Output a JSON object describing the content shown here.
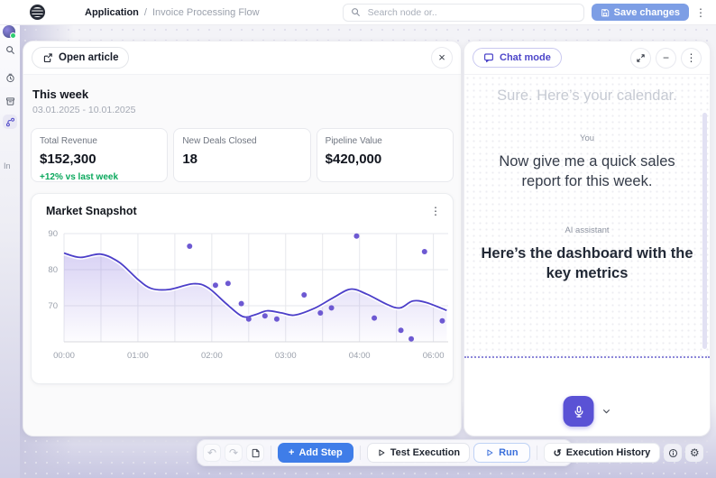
{
  "icons": {
    "close": "×",
    "kebab": "⋮",
    "minus": "−",
    "plus": "+",
    "undo": "↶",
    "redo": "↷",
    "gear": "⚙",
    "history": "↺"
  },
  "topbar": {
    "breadcrumb_app": "Application",
    "breadcrumb_sep": "/",
    "breadcrumb_page": "Invoice Processing Flow",
    "search_placeholder": "Search node or..",
    "save_button": "Save changes"
  },
  "sidebar": {
    "partial_label": "In"
  },
  "left_panel": {
    "open_article": "Open article",
    "week_title": "This week",
    "week_range": "03.01.2025 - 10.01.2025",
    "metrics": [
      {
        "label": "Total Revenue",
        "value": "$152,300",
        "delta": "+12% vs last week"
      },
      {
        "label": "New Deals Closed",
        "value": "18",
        "delta": ""
      },
      {
        "label": "Pipeline Value",
        "value": "$420,000",
        "delta": ""
      }
    ],
    "chart_title": "Market Snapshot"
  },
  "chart_data": {
    "type": "line+scatter",
    "title": "Market Snapshot",
    "x_tick_labels": [
      "00:00",
      "01:00",
      "02:00",
      "03:00",
      "04:00",
      "06:00"
    ],
    "x_tick_slots": [
      0,
      1,
      2,
      3,
      4,
      5
    ],
    "y_ticks": [
      90,
      80,
      70
    ],
    "ylim": [
      60,
      91
    ],
    "xlim": [
      0,
      5.2
    ],
    "grid": true,
    "line_series": {
      "name": "trend",
      "points": [
        [
          0,
          84.6
        ],
        [
          0.22,
          83.4
        ],
        [
          0.5,
          84.3
        ],
        [
          0.75,
          82.0
        ],
        [
          1.0,
          77.3
        ],
        [
          1.18,
          74.8
        ],
        [
          1.42,
          74.5
        ],
        [
          1.75,
          76.1
        ],
        [
          1.95,
          75.0
        ],
        [
          2.2,
          70.5
        ],
        [
          2.42,
          67.0
        ],
        [
          2.6,
          67.6
        ],
        [
          2.75,
          68.6
        ],
        [
          2.95,
          68.0
        ],
        [
          3.12,
          67.4
        ],
        [
          3.4,
          69.4
        ],
        [
          3.65,
          72.3
        ],
        [
          3.88,
          74.6
        ],
        [
          4.1,
          73.2
        ],
        [
          4.38,
          70.3
        ],
        [
          4.55,
          69.4
        ],
        [
          4.72,
          71.3
        ],
        [
          4.9,
          70.9
        ],
        [
          5.18,
          68.7
        ]
      ]
    },
    "scatter_series": {
      "name": "observations",
      "points": [
        [
          1.7,
          86.5
        ],
        [
          2.05,
          75.7
        ],
        [
          2.22,
          76.2
        ],
        [
          2.4,
          70.6
        ],
        [
          2.5,
          66.3
        ],
        [
          2.72,
          67.2
        ],
        [
          2.88,
          66.3
        ],
        [
          3.25,
          73.0
        ],
        [
          3.47,
          68.0
        ],
        [
          3.62,
          69.4
        ],
        [
          3.96,
          89.3
        ],
        [
          4.2,
          66.6
        ],
        [
          4.56,
          63.2
        ],
        [
          4.7,
          60.8
        ],
        [
          4.88,
          85.0
        ],
        [
          5.12,
          65.8
        ]
      ]
    },
    "colors": {
      "line": "#4c3fc9",
      "area": "#8f7ce0",
      "dots": "#6d59d2",
      "grid": "#e6e7ec",
      "axis": "#d8dade"
    }
  },
  "chat_panel": {
    "mode_badge": "Chat mode",
    "messages": [
      {
        "role": "",
        "text": "Sure. Here’s your calendar."
      },
      {
        "role": "You",
        "text": "Now give me a quick sales report for this week."
      },
      {
        "role": "AI assistant",
        "text": "Here’s the dashboard with the key metrics"
      }
    ]
  },
  "toolbar": {
    "add_step": "Add Step",
    "test_execution": "Test Execution",
    "run": "Run",
    "execution_history": "Execution History"
  }
}
